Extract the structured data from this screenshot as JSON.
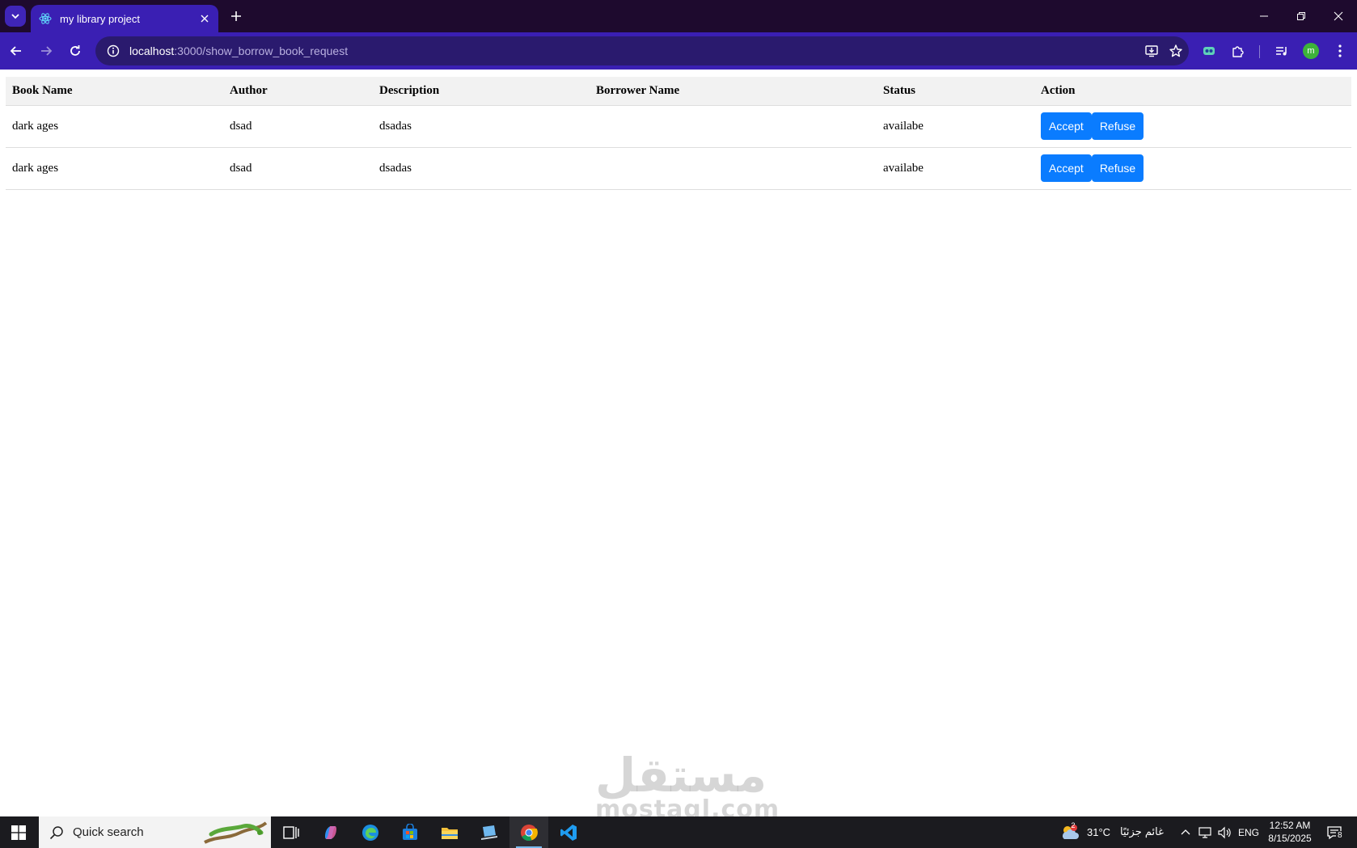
{
  "browser": {
    "tab_title": "my library project",
    "url_host": "localhost",
    "url_path": ":3000/show_borrow_book_request",
    "avatar_letter": "m"
  },
  "table": {
    "headers": [
      "Book Name",
      "Author",
      "Description",
      "Borrower Name",
      "Status",
      "Action"
    ],
    "rows": [
      {
        "book_name": "dark ages",
        "author": "dsad",
        "description": "dsadas",
        "borrower_name": "",
        "status": "availabe",
        "accept_label": "Accept",
        "refuse_label": "Refuse"
      },
      {
        "book_name": "dark ages",
        "author": "dsad",
        "description": "dsadas",
        "borrower_name": "",
        "status": "availabe",
        "accept_label": "Accept",
        "refuse_label": "Refuse"
      }
    ]
  },
  "watermark": {
    "arabic": "مستقل",
    "latin": "mostaql.com"
  },
  "taskbar": {
    "search_placeholder": "Quick search",
    "weather_temp": "31°C",
    "weather_desc": "غائم جزئيًا",
    "weather_badge": "2",
    "language": "ENG",
    "time": "12:52 AM",
    "date": "8/15/2025",
    "notification_count": "8"
  },
  "colors": {
    "accent_button": "#0a7cff",
    "chrome": "#3a1fb3",
    "tabstrip": "#1e0a2e"
  }
}
